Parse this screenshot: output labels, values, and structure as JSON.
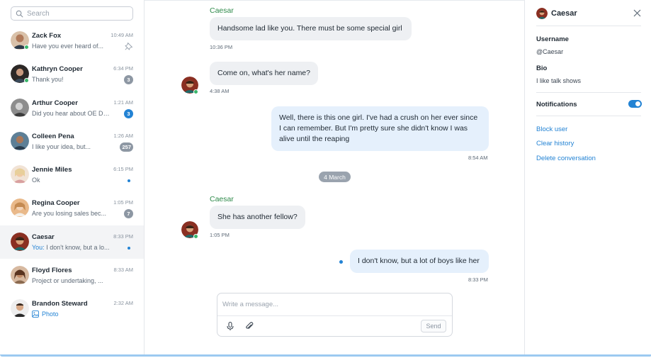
{
  "search": {
    "placeholder": "Search"
  },
  "chats": [
    {
      "name": "Zack Fox",
      "time": "10:49 AM",
      "preview": "Have you ever heard of...",
      "indicator": "pin",
      "online": true,
      "avatar_color": "#b07a5a"
    },
    {
      "name": "Kathryn Cooper",
      "time": "6:34 PM",
      "preview": "Thank you!",
      "badge": "3",
      "badge_style": "gray",
      "online": true,
      "avatar_color": "#4a3a36"
    },
    {
      "name": "Arthur Cooper",
      "time": "1:21 AM",
      "preview": "Did you hear about OE DS...",
      "badge": "3",
      "badge_style": "blue",
      "online": false,
      "avatar_color": "#6a6a6a"
    },
    {
      "name": "Colleen Pena",
      "time": "1:26 AM",
      "preview": "I like your idea, but...",
      "badge": "257",
      "badge_style": "gray",
      "online": false,
      "avatar_color": "#5d7f96"
    },
    {
      "name": "Jennie Miles",
      "time": "6:15 PM",
      "preview": "Ok",
      "indicator": "dot",
      "online": false,
      "avatar_color": "#e8c9a8"
    },
    {
      "name": "Regina Cooper",
      "time": "1:05 PM",
      "preview": "Are you losing sales bec...",
      "badge": "7",
      "badge_style": "gray",
      "online": false,
      "avatar_color": "#c98f5a"
    },
    {
      "name": "Caesar",
      "time": "8:33 PM",
      "preview_you": "You:",
      "preview": "I don't know, but a lo...",
      "indicator": "dot",
      "online": false,
      "active": true,
      "avatar_color": "#7a4a2a"
    },
    {
      "name": "Floyd Flores",
      "time": "8:33 AM",
      "preview": "Project or undertaking, ...",
      "online": false,
      "avatar_color": "#8a5a3a"
    },
    {
      "name": "Brandon Steward",
      "time": "2:32 AM",
      "preview": "Photo",
      "preview_type": "photo",
      "online": false,
      "avatar_color": "#b88a6a"
    }
  ],
  "conversation": {
    "contact": "Caesar",
    "messages": [
      {
        "sender": "Caesar",
        "text": "Handsome lad like you. There must be some special girl",
        "time": "10:36 PM",
        "dir": "in"
      },
      {
        "text": "Come on, what's her name?",
        "time": "4:38 AM",
        "dir": "in"
      },
      {
        "text": "Well, there is this one girl. I've had a crush on her ever since I can remember. But I'm pretty sure she didn't know I was alive until the reaping",
        "time": "8:54 AM",
        "dir": "out"
      },
      {
        "sender": "Caesar",
        "text": "She has another fellow?",
        "time": "1:05 PM",
        "dir": "in"
      },
      {
        "text": "I don't know, but a lot of boys like her",
        "time": "8:33 PM",
        "dir": "out"
      }
    ],
    "date_divider": "4 March"
  },
  "composer": {
    "placeholder": "Write a message...",
    "send_label": "Send"
  },
  "panel": {
    "title": "Caesar",
    "username_label": "Username",
    "username_value": "@Caesar",
    "bio_label": "Bio",
    "bio_value": "I like talk shows",
    "notifications_label": "Notifications",
    "notifications_on": true,
    "block_label": "Block user",
    "clear_label": "Clear history",
    "delete_label": "Delete conversation"
  },
  "colors": {
    "accent": "#2383d4",
    "sender": "#2e8a4a",
    "online": "#3ab56a"
  }
}
